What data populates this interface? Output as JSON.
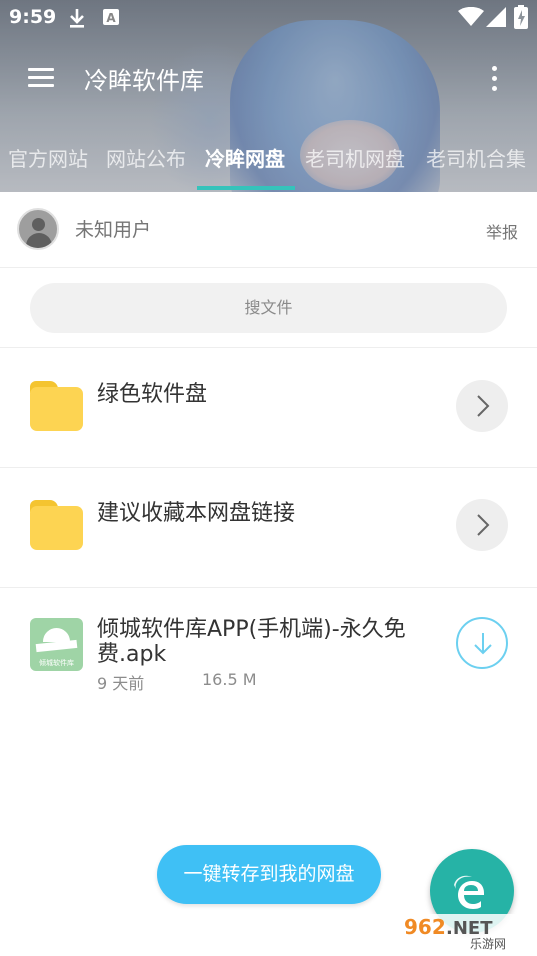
{
  "status_bar": {
    "time": "9:59",
    "icons": [
      "download-icon",
      "a-badge-icon",
      "wifi-icon",
      "signal-icon",
      "battery-charging-icon"
    ]
  },
  "toolbar": {
    "title": "冷眸软件库",
    "menu_icon": "menu-icon",
    "more_icon": "more-vertical-icon"
  },
  "tabs": [
    {
      "label": "官方网站",
      "active": false
    },
    {
      "label": "网站公布",
      "active": false
    },
    {
      "label": "冷眸网盘",
      "active": true
    },
    {
      "label": "老司机网盘",
      "active": false
    },
    {
      "label": "老司机合集",
      "active": false
    }
  ],
  "colors": {
    "accent": "#35c3bb",
    "button_blue": "#3fc0f5",
    "fab_teal": "#26b3a6",
    "folder_yellow": "#fdd452"
  },
  "user": {
    "name": "未知用户",
    "report_label": "举报"
  },
  "search": {
    "placeholder": "搜文件"
  },
  "files": [
    {
      "type": "folder",
      "name": "绿色软件盘",
      "action_icon": "chevron-right-icon"
    },
    {
      "type": "folder",
      "name": "建议收藏本网盘链接",
      "action_icon": "chevron-right-icon"
    },
    {
      "type": "apk",
      "name": "倾城软件库APP(手机端)-永久免费.apk",
      "date": "9 天前",
      "size": "16.5 M",
      "action_icon": "download-icon",
      "icon_text": "倾城软件库"
    }
  ],
  "save_button": {
    "label": "一键转存到我的网盘"
  },
  "fab": {
    "icon": "browser-e-icon"
  },
  "watermark": {
    "brand": "962.NET",
    "sub": "乐游网"
  }
}
